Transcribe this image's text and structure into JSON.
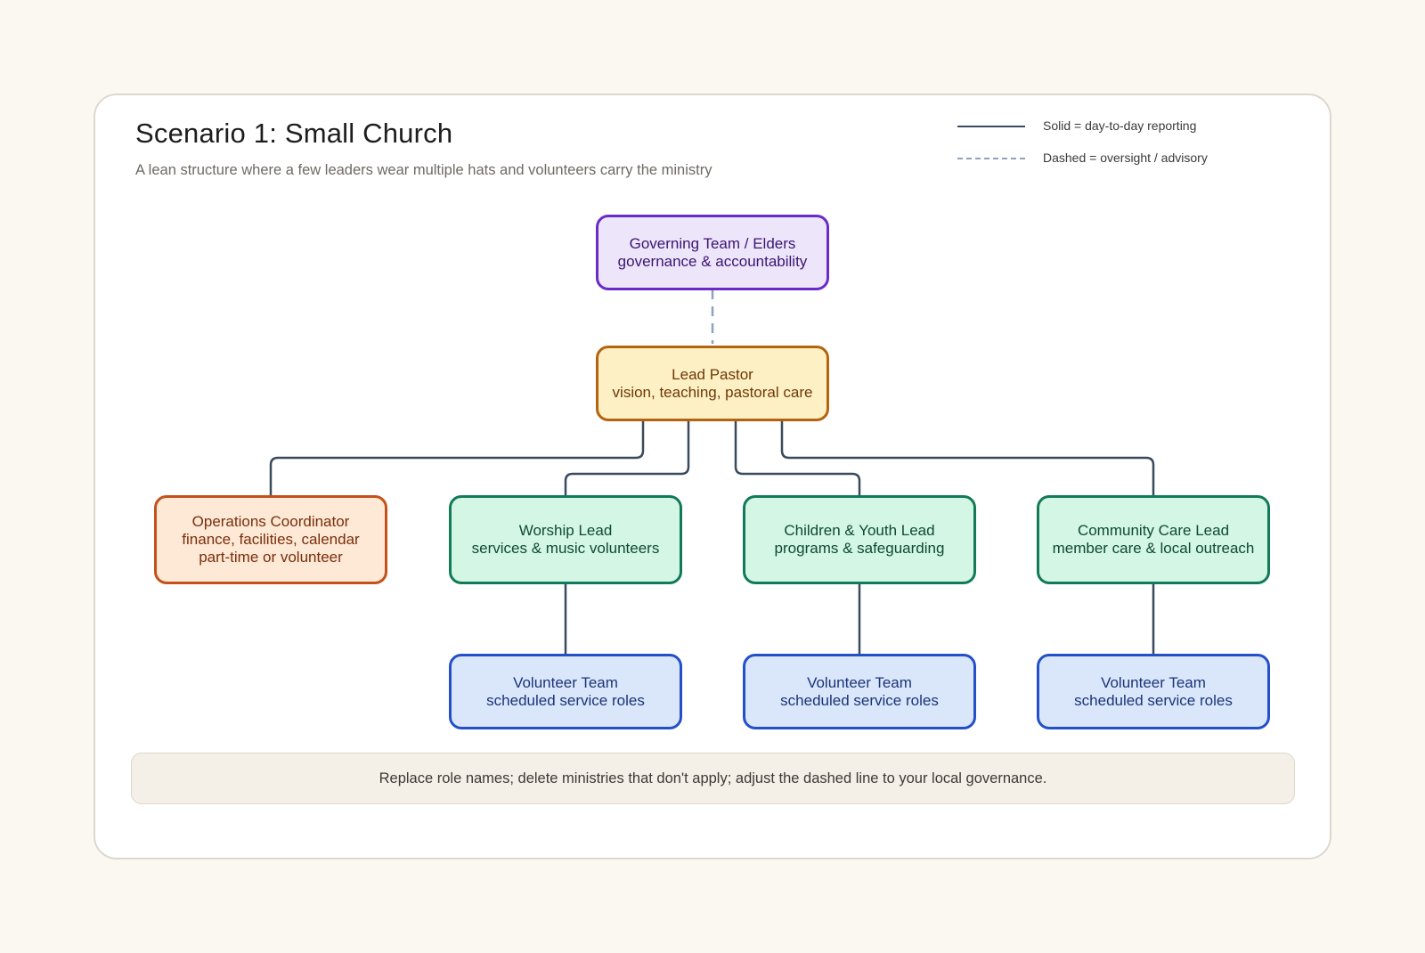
{
  "title": "Scenario 1: Small Church",
  "subtitle": "A lean structure where a few leaders wear multiple hats and volunteers carry the ministry",
  "legend": {
    "solid_label": "Solid = day-to-day reporting",
    "dashed_label": "Dashed = oversight / advisory"
  },
  "nodes": {
    "governing": {
      "line1": "Governing Team / Elders",
      "line2": "governance & accountability"
    },
    "pastor": {
      "line1": "Lead Pastor",
      "line2": "vision, teaching, pastoral care"
    },
    "operations": {
      "line1": "Operations Coordinator",
      "line2": "finance, facilities, calendar",
      "line3": "part-time or volunteer"
    },
    "worship": {
      "line1": "Worship Lead",
      "line2": "services & music volunteers"
    },
    "children": {
      "line1": "Children & Youth Lead",
      "line2": "programs & safeguarding"
    },
    "community": {
      "line1": "Community Care Lead",
      "line2": "member care & local outreach"
    },
    "volunteers_worship": {
      "line1": "Volunteer Team",
      "line2": "scheduled service roles"
    },
    "volunteers_children": {
      "line1": "Volunteer Team",
      "line2": "scheduled service roles"
    },
    "volunteers_community": {
      "line1": "Volunteer Team",
      "line2": "scheduled service roles"
    }
  },
  "note": "Replace role names; delete ministries that don't apply; adjust the dashed line to your local governance.",
  "colors": {
    "solid_connector": "#3b4a5a",
    "dashed_connector": "#8ea3bb",
    "governance": "#6a2bc9",
    "pastor": "#b4630f",
    "operations": "#c4511a",
    "ministry": "#127a58",
    "volunteer": "#2350c9"
  }
}
